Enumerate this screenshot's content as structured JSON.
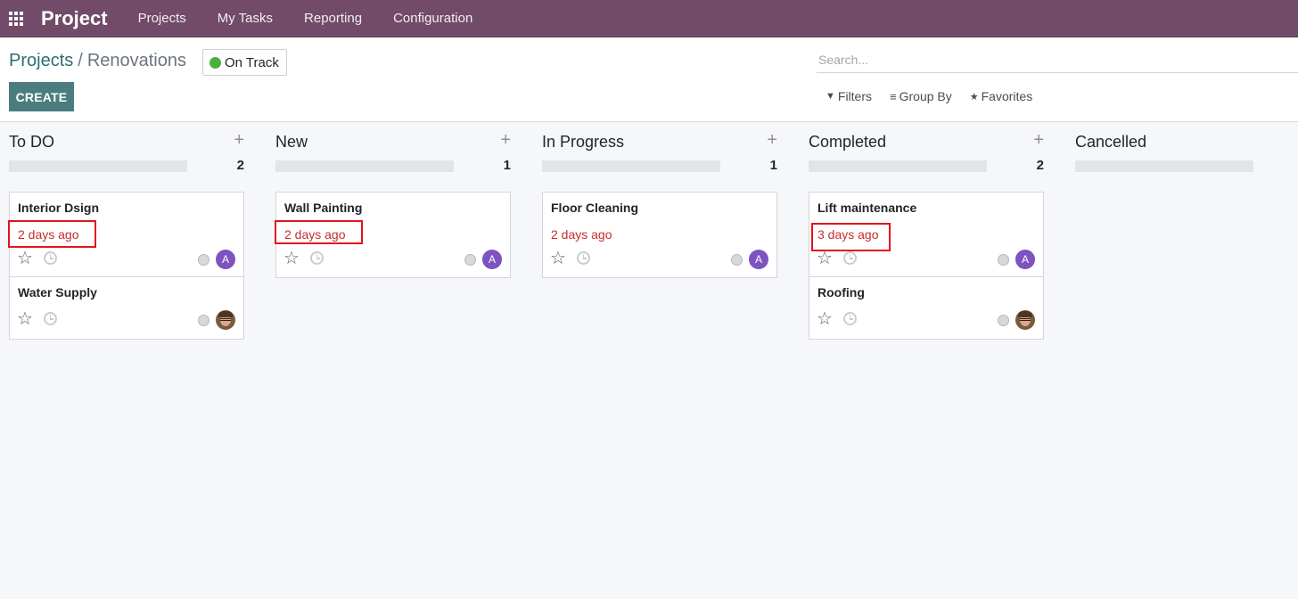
{
  "navbar": {
    "app_name": "Project",
    "menu": [
      "Projects",
      "My Tasks",
      "Reporting",
      "Configuration"
    ]
  },
  "breadcrumb": {
    "parent": "Projects",
    "separator": "/",
    "current": "Renovations"
  },
  "status": {
    "label": "On Track",
    "color": "#4cae3f"
  },
  "actions": {
    "create_label": "CREATE"
  },
  "search": {
    "placeholder": "Search...",
    "filters_label": "Filters",
    "group_by_label": "Group By",
    "favorites_label": "Favorites"
  },
  "columns": [
    {
      "title": "To DO",
      "count": "2",
      "cards": [
        {
          "title": "Interior Dsign",
          "date": "2 days ago",
          "assignee": "A",
          "highlighted": true
        },
        {
          "title": "Water Supply",
          "assignee_photo": true
        }
      ]
    },
    {
      "title": "New",
      "count": "1",
      "cards": [
        {
          "title": "Wall Painting",
          "date": "2 days ago",
          "assignee": "A",
          "highlighted": true
        }
      ]
    },
    {
      "title": "In Progress",
      "count": "1",
      "cards": [
        {
          "title": "Floor Cleaning",
          "date": "2 days ago",
          "assignee": "A",
          "highlighted": false
        }
      ]
    },
    {
      "title": "Completed",
      "count": "2",
      "cards": [
        {
          "title": "Lift maintenance",
          "date": "3 days ago",
          "assignee": "A",
          "highlighted": true
        },
        {
          "title": "Roofing",
          "assignee_photo": true
        }
      ]
    },
    {
      "title": "Cancelled",
      "cards": []
    }
  ],
  "colors": {
    "navbar": "#714b67",
    "primary_button": "#4b7d80",
    "overdue_date": "#c52d2d",
    "highlight_box": "#e3141c",
    "avatar": "#7c53c0"
  }
}
